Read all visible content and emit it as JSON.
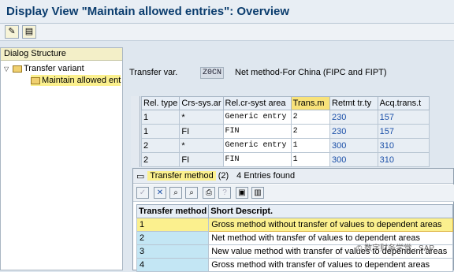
{
  "window": {
    "title": "Display View \"Maintain allowed entries\": Overview"
  },
  "toolbar": {
    "icons": [
      "display-change-icon",
      "table-view-icon"
    ]
  },
  "dialog_structure": {
    "header": "Dialog Structure",
    "items": [
      {
        "label": "Transfer variant",
        "expanded": true
      },
      {
        "label": "Maintain allowed ent"
      }
    ]
  },
  "form": {
    "label": "Transfer var.",
    "value": "Z0CN",
    "description": "Net method-For China (FIPC and FIPT)"
  },
  "table": {
    "headers": [
      "Rel. type",
      "Crs-sys.ar",
      "Rel.cr-syst area",
      "Trans.m",
      "Retmt tr.ty",
      "Acq.trans.t"
    ],
    "highlighted_column": 3,
    "rows": [
      [
        "1",
        "*",
        "Generic entry",
        "2",
        "230",
        "157"
      ],
      [
        "1",
        "FI",
        "FIN",
        "2",
        "230",
        "157"
      ],
      [
        "2",
        "*",
        "Generic entry",
        "1",
        "300",
        "310"
      ],
      [
        "2",
        "FI",
        "FIN",
        "1",
        "300",
        "310"
      ]
    ]
  },
  "popup": {
    "title": "Transfer method",
    "count": "(2)",
    "entries_found": "4 Entries found",
    "headers": [
      "Transfer method",
      "Short Descript."
    ],
    "rows": [
      {
        "code": "1",
        "desc": "Gross method without transfer of values to dependent areas",
        "selected": true
      },
      {
        "code": "2",
        "desc": "Net method with transfer of values to dependent areas"
      },
      {
        "code": "3",
        "desc": "New value method with transfer of values to dependent areas"
      },
      {
        "code": "4",
        "desc": "Gross method with transfer of values to dependent areas"
      }
    ]
  },
  "colors": {
    "title": "#0b3d6e",
    "highlight": "#fbf08e",
    "key_cell": "#c3e6f4",
    "number": "#1a4fa8"
  },
  "watermark": "© 数字财务学堂 · SAP"
}
